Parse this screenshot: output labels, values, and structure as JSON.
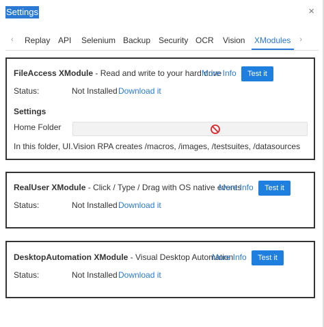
{
  "window": {
    "title": "Settings",
    "close_glyph": "×"
  },
  "tabs": [
    {
      "label": "Replay",
      "active": false
    },
    {
      "label": "API",
      "active": false
    },
    {
      "label": "Selenium",
      "active": false
    },
    {
      "label": "Backup",
      "active": false
    },
    {
      "label": "Security",
      "active": false
    },
    {
      "label": "OCR",
      "active": false
    },
    {
      "label": "Vision",
      "active": false
    },
    {
      "label": "XModules",
      "active": true
    }
  ],
  "tab_arrows": {
    "left": "‹",
    "right": "›"
  },
  "modules": [
    {
      "name": "FileAccess XModule",
      "description": " - Read and write to your hard drive",
      "more_info": "More Info",
      "test_label": "Test it",
      "status_label": "Status:",
      "status_value": "Not Installed",
      "download_label": "Download it",
      "settings": {
        "title": "Settings",
        "home_folder_label": "Home Folder",
        "home_folder_value": "",
        "hint": "In this folder, UI.Vision RPA creates /macros, /images, /testsuites, /datasources"
      }
    },
    {
      "name": "RealUser XModule",
      "description": " - Click / Type / Drag with OS native events",
      "more_info": "More Info",
      "test_label": "Test it",
      "status_label": "Status:",
      "status_value": "Not Installed",
      "download_label": "Download it"
    },
    {
      "name": "DesktopAutomation XModule",
      "description": " - Visual Desktop Automation",
      "more_info": "More Info",
      "test_label": "Test it",
      "status_label": "Status:",
      "status_value": "Not Installed",
      "download_label": "Download it"
    }
  ],
  "colors": {
    "accent": "#2a7ad5",
    "button": "#1e7fde",
    "forbidden_icon": "#d9272e"
  },
  "icons": {
    "forbidden": "no-entry-icon"
  }
}
